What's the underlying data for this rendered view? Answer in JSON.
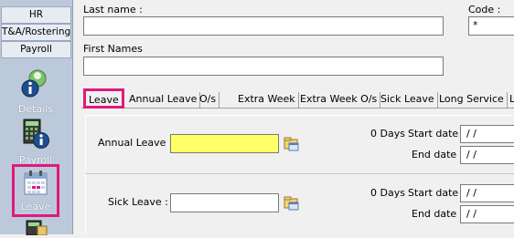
{
  "sidebar": {
    "tabs": [
      "HR",
      "T&A/Rostering",
      "Payroll"
    ],
    "buttons": [
      {
        "label": "Details",
        "icon": "details-icon"
      },
      {
        "label": "Payroll",
        "icon": "payroll-icon"
      },
      {
        "label": "Leave",
        "icon": "leave-calendar-icon",
        "selected": true
      },
      {
        "label": "",
        "icon": "next-module-icon"
      }
    ]
  },
  "form": {
    "last_name_label": "Last name :",
    "last_name_value": "",
    "code_label": "Code :",
    "code_value": "*",
    "first_names_label": "First Names",
    "first_names_value": ""
  },
  "tabs": [
    "Leave",
    "Annual Leave",
    "O/s",
    "Extra Week",
    "Extra Week O/s",
    "Sick Leave",
    "Long Service",
    "L"
  ],
  "active_tab": "Leave",
  "panels": [
    {
      "label": "Annual Leave :",
      "value": "",
      "days": "0 Days",
      "start_label": "Start date :",
      "start_value": " / /",
      "end_label": "End date :",
      "end_value": " / /"
    },
    {
      "label": "Sick Leave :",
      "value": "",
      "days": "0 Days",
      "start_label": "Start date :",
      "start_value": " / /",
      "end_label": "End date :",
      "end_value": " / /"
    }
  ],
  "colors": {
    "highlight": "#e0197d",
    "active_field": "#ffff66",
    "sidebar_bg": "#bcc9da"
  }
}
